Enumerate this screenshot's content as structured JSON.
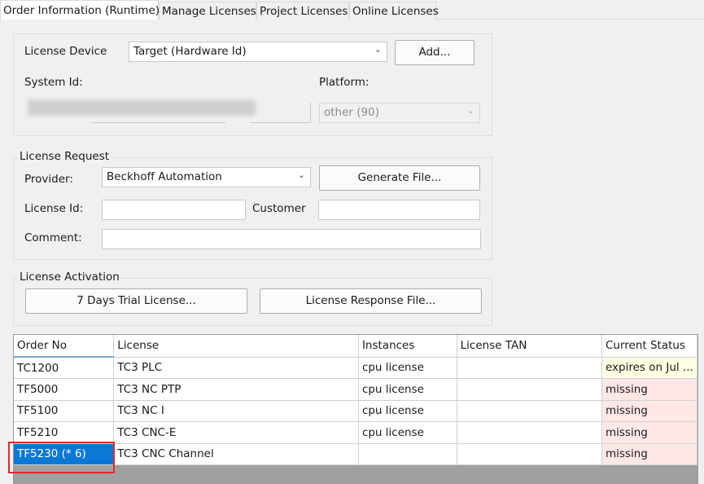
{
  "tabs": [
    "Order Information (Runtime)",
    "Manage Licenses",
    "Project Licenses",
    "Online Licenses"
  ],
  "device": {
    "license_device_label": "License Device",
    "license_device_value": "Target (Hardware Id)",
    "add_button": "Add...",
    "system_id_label": "System Id:",
    "platform_label": "Platform:",
    "platform_value": "other (90)"
  },
  "request": {
    "title": "License Request",
    "provider_label": "Provider:",
    "provider_value": "Beckhoff Automation",
    "generate_button": "Generate File...",
    "license_id_label": "License Id:",
    "license_id_value": "",
    "customer_label": "Customer",
    "customer_value": "",
    "comment_label": "Comment:",
    "comment_value": ""
  },
  "activation": {
    "title": "License Activation",
    "trial_button": "7 Days Trial License...",
    "response_button": "License Response File..."
  },
  "table": {
    "headers": [
      "Order No",
      "License",
      "Instances",
      "License TAN",
      "Current Status"
    ],
    "rows": [
      {
        "order_no": "TC1200",
        "license": "TC3 PLC",
        "instances": "cpu license",
        "tan": "",
        "status": "expires on Jul ..."
      },
      {
        "order_no": "TF5000",
        "license": "TC3 NC PTP",
        "instances": "cpu license",
        "tan": "",
        "status": "missing"
      },
      {
        "order_no": "TF5100",
        "license": "TC3 NC I",
        "instances": "cpu license",
        "tan": "",
        "status": "missing"
      },
      {
        "order_no": "TF5210",
        "license": "TC3 CNC-E",
        "instances": "cpu license",
        "tan": "",
        "status": "missing"
      },
      {
        "order_no": "TF5230 (* 6)",
        "license": "TC3 CNC Channel",
        "instances": "",
        "tan": "",
        "status": "missing"
      }
    ]
  },
  "colors": {
    "selection": "#0b78d6",
    "status_missing_bg": "#ffe7e7",
    "status_expiring_bg": "#fffde3",
    "highlight_border": "#e02a2a"
  }
}
